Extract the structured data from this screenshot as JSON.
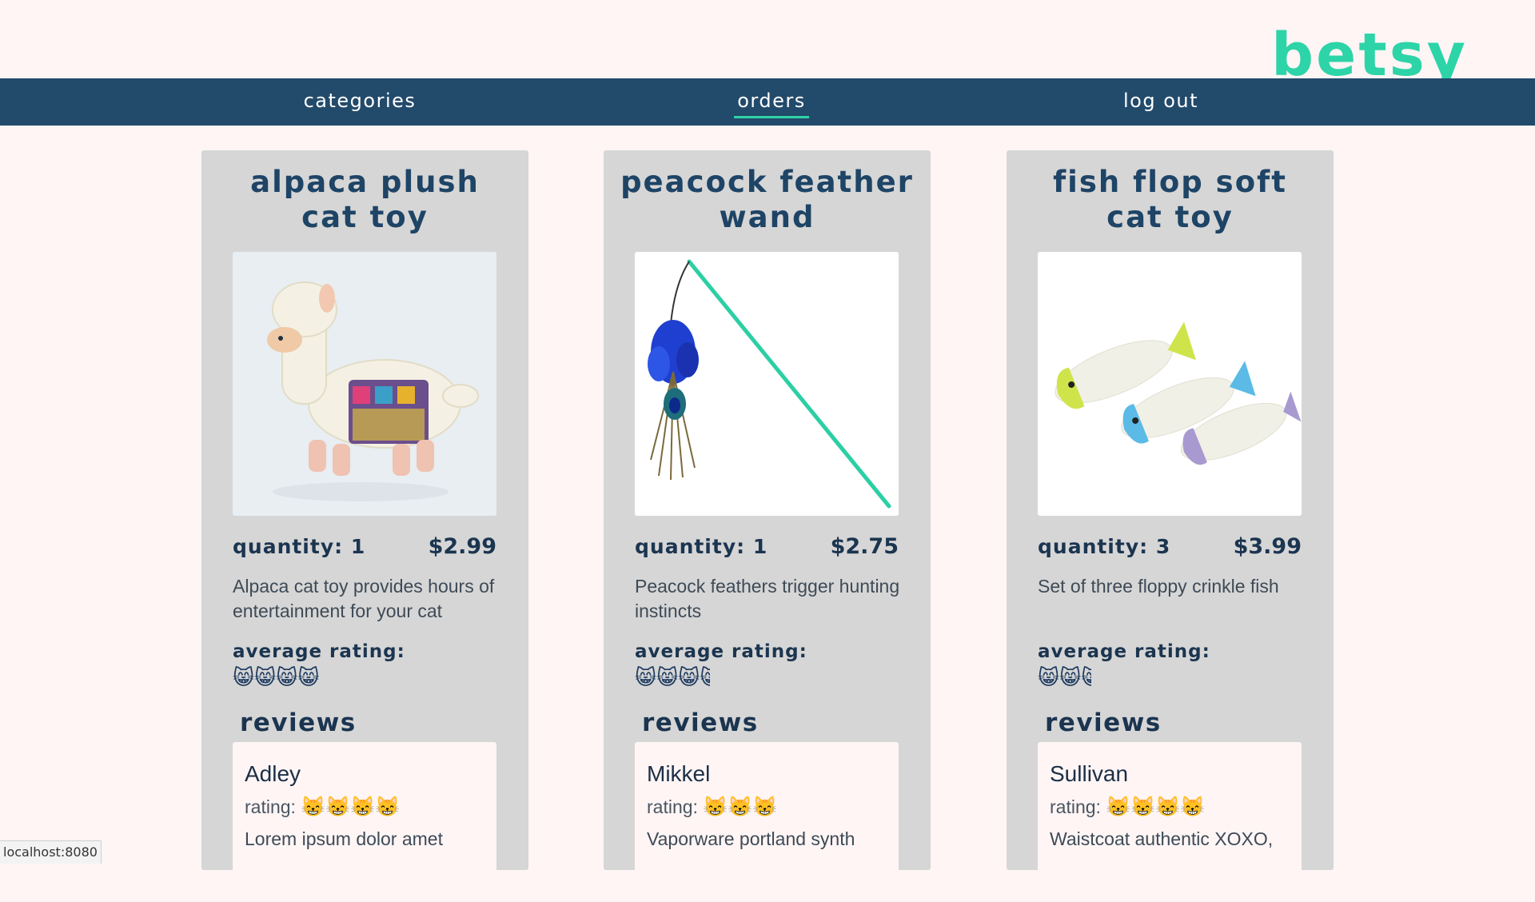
{
  "brand": {
    "logo": "betsy",
    "accent_color": "#2dd4a7"
  },
  "nav": {
    "items": [
      {
        "label": "categories",
        "active": false
      },
      {
        "label": "orders",
        "active": true
      },
      {
        "label": "log out",
        "active": false
      }
    ]
  },
  "labels": {
    "quantity_prefix": "quantity:",
    "average_rating": "average rating:",
    "reviews_heading": "reviews",
    "rating_prefix": "rating:"
  },
  "products": [
    {
      "name": "alpaca plush cat toy",
      "image": "alpaca-plush-image",
      "quantity": "quantity: 1",
      "price": "$2.99",
      "description": "Alpaca cat toy provides hours of entertainment for your cat",
      "average_rating": "😸😸😸😸",
      "review": {
        "author": "Adley",
        "rating": "😸😸😸😸",
        "text": "Lorem ipsum dolor amet"
      }
    },
    {
      "name": "peacock feather wand",
      "image": "peacock-wand-image",
      "quantity": "quantity: 1",
      "price": "$2.75",
      "description": "Peacock feathers trigger hunting instincts",
      "average_rating": "😸😸😸",
      "average_rating_half": true,
      "review": {
        "author": "Mikkel",
        "rating": "😸😸😸",
        "text": "Vaporware portland synth"
      }
    },
    {
      "name": "fish flop soft cat toy",
      "image": "fish-toy-image",
      "quantity": "quantity: 3",
      "price": "$3.99",
      "description": "Set of three floppy crinkle fish",
      "average_rating": "😸😸",
      "average_rating_half": true,
      "review": {
        "author": "Sullivan",
        "rating": "😸😸😸😸",
        "text": "Waistcoat authentic XOXO,"
      }
    }
  ],
  "status_bar": {
    "url": "localhost:8080"
  }
}
